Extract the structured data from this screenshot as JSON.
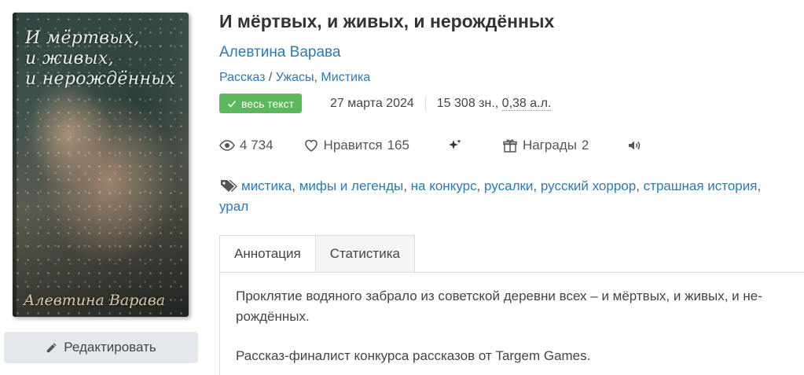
{
  "cover": {
    "title": "И мёртвых,\nи живых,\nи нерождённых",
    "author": "Алевтина Варава"
  },
  "edit_button_label": "Редактировать",
  "book": {
    "title": "И мёртвых, и живых, и нерождённых",
    "author": "Алевтина Варава",
    "genres": {
      "type": "Рассказ",
      "separator": " / ",
      "items": [
        "Ужасы",
        "Мистика"
      ]
    }
  },
  "meta": {
    "badge": "весь текст",
    "date": "27 марта 2024",
    "size_chars": "15 308 зн., ",
    "size_al": "0,38 а.л."
  },
  "stats": {
    "views": "4 734",
    "likes_label": "Нравится",
    "likes_count": "165",
    "awards_label": "Награды",
    "awards_count": "2"
  },
  "tags": [
    "мистика",
    "мифы и легенды",
    "на конкурс",
    "русалки",
    "русский хоррор",
    "страшная история",
    "урал"
  ],
  "tabs": {
    "annotation": "Аннотация",
    "statistics": "Статистика"
  },
  "annotation": {
    "paragraph1": "Проклятие водяного забрало из советской деревни всех – и мёртвых, и живых, и не-рождённых.",
    "paragraph2": "Рассказ-финалист конкурса рассказов от Targem Games."
  },
  "colors": {
    "link": "#2a7ab8",
    "badge": "#5cb85c",
    "edit_button_bg": "#e4e8ec"
  }
}
